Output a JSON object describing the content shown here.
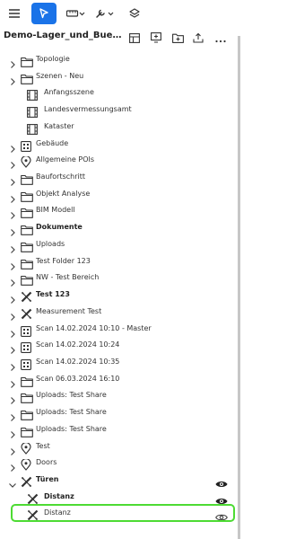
{
  "toolbar": {
    "icons": [
      "menu-icon",
      "cursor-arrow-icon",
      "ruler-dropdown-icon",
      "wrench-dropdown-icon",
      "layers-icon"
    ],
    "accent": "#1a73e8"
  },
  "project": {
    "title": "Demo-Lager_und_Bueroge...",
    "actions": [
      "grid-view-icon",
      "screen-add-icon",
      "folder-add-icon",
      "upload-icon",
      "more-icon"
    ]
  },
  "tree": {
    "items": [
      {
        "label": "Topologie",
        "icon": "folder-icon",
        "level": 0,
        "expandable": true,
        "bold": false
      },
      {
        "label": "Szenen - Neu",
        "icon": "folder-icon",
        "level": 0,
        "expandable": true,
        "bold": false
      },
      {
        "label": "Anfangsszene",
        "icon": "scene-icon",
        "level": 1,
        "expandable": false,
        "bold": false
      },
      {
        "label": "Landesvermessungsamt",
        "icon": "scene-icon",
        "level": 1,
        "expandable": false,
        "bold": false
      },
      {
        "label": "Kataster",
        "icon": "scene-icon",
        "level": 1,
        "expandable": false,
        "bold": false
      },
      {
        "label": "Gebäude",
        "icon": "grid-icon",
        "level": 0,
        "expandable": true,
        "bold": false
      },
      {
        "label": "Allgemeine POIs",
        "icon": "pin-icon",
        "level": 0,
        "expandable": true,
        "bold": false
      },
      {
        "label": "Baufortschritt",
        "icon": "folder-icon",
        "level": 0,
        "expandable": true,
        "bold": false
      },
      {
        "label": "Objekt Analyse",
        "icon": "folder-icon",
        "level": 0,
        "expandable": true,
        "bold": false
      },
      {
        "label": "BIM Modell",
        "icon": "folder-icon",
        "level": 0,
        "expandable": true,
        "bold": false
      },
      {
        "label": "Dokumente",
        "icon": "folder-icon",
        "level": 0,
        "expandable": true,
        "bold": true
      },
      {
        "label": "Uploads",
        "icon": "folder-icon",
        "level": 0,
        "expandable": true,
        "bold": false
      },
      {
        "label": "Test Folder 123",
        "icon": "folder-icon",
        "level": 0,
        "expandable": true,
        "bold": false
      },
      {
        "label": "NW - Test Bereich",
        "icon": "folder-icon",
        "level": 0,
        "expandable": true,
        "bold": false
      },
      {
        "label": "Test 123",
        "icon": "measure-icon",
        "level": 0,
        "expandable": true,
        "bold": true
      },
      {
        "label": "Measurement Test",
        "icon": "measure-icon",
        "level": 0,
        "expandable": true,
        "bold": false
      },
      {
        "label": "Scan 14.02.2024 10:10 - Master",
        "icon": "grid-icon",
        "level": 0,
        "expandable": true,
        "bold": false
      },
      {
        "label": "Scan 14.02.2024 10:24",
        "icon": "grid-icon",
        "level": 0,
        "expandable": true,
        "bold": false
      },
      {
        "label": "Scan 14.02.2024 10:35",
        "icon": "grid-icon",
        "level": 0,
        "expandable": true,
        "bold": false
      },
      {
        "label": "Scan 06.03.2024 16:10",
        "icon": "folder-icon",
        "level": 0,
        "expandable": true,
        "bold": false
      },
      {
        "label": "Uploads: Test Share",
        "icon": "folder-icon",
        "level": 0,
        "expandable": true,
        "bold": false
      },
      {
        "label": "Uploads: Test Share",
        "icon": "folder-icon",
        "level": 0,
        "expandable": true,
        "bold": false
      },
      {
        "label": "Uploads: Test Share",
        "icon": "folder-icon",
        "level": 0,
        "expandable": true,
        "bold": false
      },
      {
        "label": "Test",
        "icon": "pin-icon",
        "level": 0,
        "expandable": true,
        "bold": false
      },
      {
        "label": "Doors",
        "icon": "pin-icon",
        "level": 0,
        "expandable": true,
        "bold": false
      },
      {
        "label": "Türen",
        "icon": "measure-icon",
        "level": 0,
        "expandable": true,
        "expanded": true,
        "bold": true,
        "eye": "eye-filled-icon"
      },
      {
        "label": "Distanz",
        "icon": "measure-icon",
        "level": 1,
        "expandable": false,
        "bold": true,
        "eye": "eye-filled-icon"
      },
      {
        "label": "Distanz",
        "icon": "measure-icon",
        "level": 1,
        "expandable": false,
        "bold": false,
        "eye": "eye-outline-icon",
        "highlighted": true
      }
    ]
  },
  "colors": {
    "highlight": "#4ddb33",
    "icon": "#333333"
  }
}
